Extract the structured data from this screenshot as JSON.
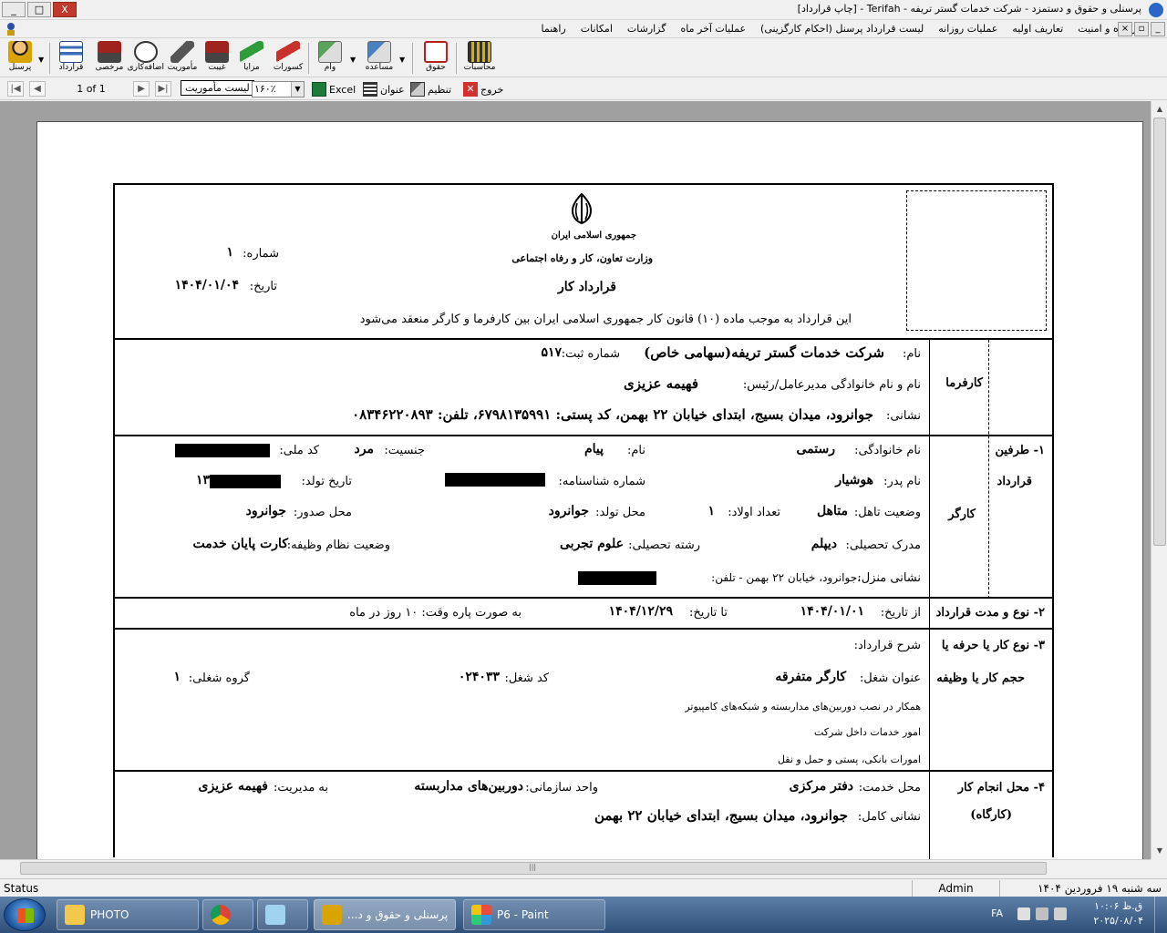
{
  "window": {
    "title": "پرسنلی و حقوق و دستمزد - شرکت خدمات گستر تریفه - Terifah - [چاپ قرارداد]",
    "minimize": "_",
    "maximize": "□",
    "close": "X"
  },
  "menu": {
    "items": [
      "پرونده و امنیت",
      "تعاریف اولیه",
      "عملیات روزانه",
      "لیست قرارداد پرسنل (احکام کارگزینی)",
      "عملیات آخر ماه",
      "گزارشات",
      "امکانات",
      "راهنما"
    ]
  },
  "toolbar": {
    "items": [
      "پرسنل",
      "قرارداد",
      "مرخصی",
      "اضافه‌کاری",
      "مأموریت",
      "غیبت",
      "مزایا",
      "کسورات",
      "وام",
      "مساعده",
      "حقوق",
      "محاسبات"
    ]
  },
  "navbar": {
    "page_info": "1 of 1",
    "tooltip": "لیست مأموریت",
    "zoom": "۱۶۰٪",
    "excel": "Excel",
    "title_btn": "عنوان",
    "settings_btn": "تنظیم",
    "exit_btn": "خروج"
  },
  "doc": {
    "republic": "جمهوری اسلامی ایران",
    "ministry": "وزارت تعاون، کار و رفاه اجتماعی",
    "contract_title": "قرارداد کار",
    "number_label": "شماره:",
    "number_value": "۱",
    "date_label": "تاریخ:",
    "date_value": "۱۴۰۴/۰۱/۰۴",
    "intro": "این قرارداد به موجب ماده (۱۰) قانون کار جمهوری اسلامی ایران بین کارفرما و کارگر منعقد می‌شود",
    "parties_title_1": "۱- طرفین",
    "parties_title_2": "قرارداد",
    "employer": {
      "title": "کارفرما",
      "name_label": "نام:",
      "name_value": "شرکت خدمات گستر تریفه(سهامی خاص)",
      "reg_label": "شماره ثبت:",
      "reg_value": "۵۱۷",
      "ceo_label": "نام و نام خانوادگی مدیرعامل/رئیس:",
      "ceo_value": "فهیمه عزیزی",
      "address_label": "نشانی:",
      "address_value": "جوانرود، میدان بسیج، ابتدای خیابان ۲۲ بهمن، کد پستی: ۶۷۹۸۱۳۵۹۹۱، تلفن: ۰۸۳۴۶۲۲۰۸۹۳"
    },
    "worker": {
      "title": "کارگر",
      "lastname_label": "نام خانوادگی:",
      "lastname_value": "رستمی",
      "firstname_label": "نام:",
      "firstname_value": "پیام",
      "gender_label": "جنسیت:",
      "gender_value": "مرد",
      "nid_label": "کد ملی:",
      "father_label": "نام پدر:",
      "father_value": "هوشیار",
      "idno_label": "شماره شناسنامه:",
      "birth_label": "تاریخ تولد:",
      "birth_value_partial": "۱۳",
      "marital_label": "وضعیت تاهل:",
      "marital_value": "متاهل",
      "children_label": "تعداد اولاد:",
      "children_value": "۱",
      "birthplace_label": "محل تولد:",
      "birthplace_value": "جوانرود",
      "issue_label": "محل صدور:",
      "issue_value": "جوانرود",
      "edu_label": "مدرک تحصیلی:",
      "edu_value": "دیپلم",
      "field_label": "رشته تحصیلی:",
      "field_value": "علوم تجربی",
      "military_label": "وضعیت نظام وظیفه:",
      "military_value": "کارت پایان خدمت",
      "home_label": "نشانی منزل:",
      "home_value": "،جوانرود، خیابان ۲۲ بهمن - تلفن:"
    },
    "duration": {
      "title": "۲- نوع و مدت قرارداد",
      "from_label": "از تاریخ:",
      "from_value": "۱۴۰۴/۰۱/۰۱",
      "to_label": "تا تاریخ:",
      "to_value": "۱۴۰۴/۱۲/۲۹",
      "parttime": "به صورت پاره وقت: ۱۰ روز در ماه"
    },
    "job": {
      "title_1": "۳- نوع کار یا حرفه یا",
      "title_2": "حجم کار یا وظیفه",
      "desc_label": "شرح قرارداد:",
      "jobtitle_label": "عنوان شغل:",
      "jobtitle_value": "کارگر متفرقه",
      "code_label": "کد شغل:",
      "code_value": "۰۲۴۰۳۳",
      "group_label": "گروه شغلی:",
      "group_value": "۱",
      "line1": "همکار در نصب دوربین‌های مداربسته و شبکه‌های کامپیوتر",
      "line2": "امور خدمات داخل شرکت",
      "line3": "امورات بانکی، پستی و حمل و نقل"
    },
    "place": {
      "title_1": "۴- محل انجام کار",
      "title_2": "(کارگاه)",
      "service_label": "محل خدمت:",
      "service_value": "دفتر مرکزی",
      "unit_label": "واحد سازمانی:",
      "unit_value": "دوربین‌های مداربسته",
      "manager_label": "به مدیریت:",
      "manager_value": "فهیمه عزیزی",
      "address_label": "نشانی کامل:",
      "address_value": "جوانرود، میدان بسیج، ابتدای خیابان ۲۲ بهمن"
    }
  },
  "status": {
    "left": "Status",
    "user": "Admin",
    "date": "سه شنبه ۱۹ فروردین ۱۴۰۴"
  },
  "taskbar": {
    "tasks": [
      "PHOTO",
      "...پرسنلی و حقوق و د",
      "P6 - Paint"
    ],
    "lang": "FA",
    "time": "ق.ظ ۱۰:۰۶",
    "date": "۲۰۲۵/۰۸/۰۴"
  },
  "colors": {
    "excel": "#1d7a3a",
    "exit": "#d32f2f",
    "taskbar": "#3a5f8f"
  }
}
